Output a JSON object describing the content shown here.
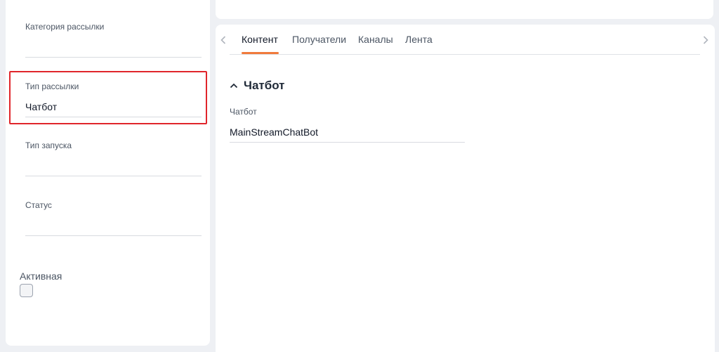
{
  "left_panel": {
    "fields": [
      {
        "label": "Категория рассылки",
        "value": ""
      },
      {
        "label": "Тип рассылки",
        "value": "Чатбот"
      },
      {
        "label": "Тип запуска",
        "value": ""
      },
      {
        "label": "Статус",
        "value": ""
      }
    ],
    "active_label": "Активная",
    "active_checked": false
  },
  "tabs": {
    "items": [
      "Контент",
      "Получатели",
      "Каналы",
      "Лента"
    ],
    "active": "Контент"
  },
  "section": {
    "title": "Чатбот",
    "field_label": "Чатбот",
    "field_value": "MainStreamChatBot"
  },
  "colors": {
    "accent": "#f07a3c",
    "highlight": "#e0252b"
  }
}
